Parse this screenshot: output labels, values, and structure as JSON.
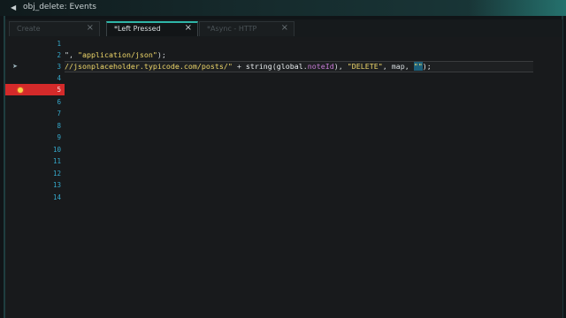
{
  "window": {
    "title": "obj_delete: Events"
  },
  "tabs": [
    {
      "label": "Create",
      "active": false,
      "close": "×"
    },
    {
      "label": "*Left Pressed",
      "active": true,
      "close": "×"
    },
    {
      "label": "*Async - HTTP",
      "active": false,
      "close": "×"
    }
  ],
  "editor": {
    "line_numbers": [
      "1",
      "2",
      "3",
      "4",
      "5",
      "6",
      "7",
      "8",
      "9",
      "10",
      "11",
      "12",
      "13",
      "14"
    ],
    "breakpoint_line": 5,
    "current_line": 3,
    "line2": {
      "t1": "\", ",
      "t2": "\"application/json\"",
      "t3": ");"
    },
    "line3": {
      "t1": "//jsonplaceholder.typicode.com/posts/\"",
      "t2": " + ",
      "t3": "string(",
      "t4": "global",
      "t5": ".",
      "t6": "noteId",
      "t7": "), ",
      "t8": "\"DELETE\"",
      "t9": ", map, ",
      "t10": "\"\"",
      "t11": ");"
    }
  },
  "colors": {
    "accent": "#2fb6a8",
    "breakpoint": "#d42a2a",
    "string": "#f0d86a",
    "line_number": "#35a7c9",
    "variable": "#c97bd8"
  }
}
